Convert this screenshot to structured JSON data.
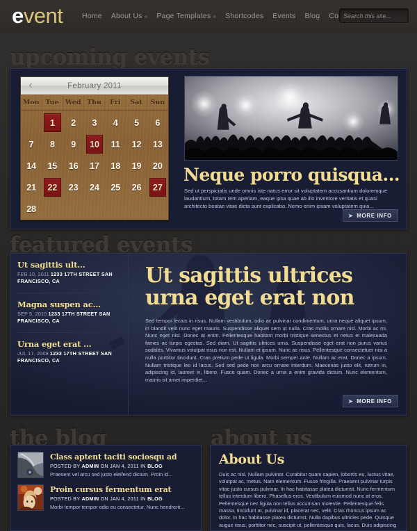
{
  "header": {
    "logo_primary": "e",
    "logo_secondary": "vent",
    "nav": [
      {
        "label": "Home",
        "caret": ""
      },
      {
        "label": "About Us",
        "caret": "»"
      },
      {
        "label": "Page Templates",
        "caret": "»"
      },
      {
        "label": "Shortcodes",
        "caret": ""
      },
      {
        "label": "Events",
        "caret": ""
      },
      {
        "label": "Blog",
        "caret": ""
      },
      {
        "label": "Contact",
        "caret": ""
      }
    ],
    "search": {
      "placeholder": "Search this site...",
      "value": "",
      "icon": "search-icon"
    }
  },
  "sections": {
    "upcoming_heading": "upcoming events",
    "featured_heading": "featured events",
    "blog_heading": "the blog",
    "about_heading": "about us"
  },
  "calendar": {
    "prev_icon": "‹",
    "title": "February 2011",
    "daynames": [
      "Mon",
      "Tue",
      "Wed",
      "Thu",
      "Fri",
      "Sat",
      "Sun"
    ],
    "lead_blanks": 1,
    "days": [
      1,
      2,
      3,
      4,
      5,
      6,
      7,
      8,
      9,
      10,
      11,
      12,
      13,
      14,
      15,
      16,
      17,
      18,
      19,
      20,
      21,
      22,
      23,
      24,
      25,
      26,
      27,
      28
    ],
    "event_days": [
      1,
      10,
      22,
      27
    ]
  },
  "upcoming": {
    "photo_alt": "concert-crowd-photo",
    "title": "Neque porro quisqua...",
    "description": "Sed ut perspiciatis unde omnis iste natus error sit voluptatem accusantium doloremque laudantium, totam rem aperiam, eaque ipsa quae ab illo inventore veritatis et quasi architecto beatae vitae dicta sunt explicabo. Nemo enim ipsam voluptatem quia...",
    "more_info_label": "MORE INFO",
    "more_info_arrow": "➤"
  },
  "featured": {
    "items": [
      {
        "title": "Ut sagittis ult...",
        "date": "FEB 10, 2011",
        "address": "1233 17TH STREET SAN FRANCISCO, CA"
      },
      {
        "title": "Magna suspen ac...",
        "date": "SEP 5, 2010",
        "address": "1233 17TH STREET SAN FRANCISCO, CA"
      },
      {
        "title": "Urna eget erat ...",
        "date": "JUL 17, 2008",
        "address": "1233 17TH STREET SAN FRANCISCO, CA"
      }
    ],
    "title": "Ut sagittis ultrices urna eget erat non",
    "body": "Sed tempor lectus in risus. Nullam vestibulum, odio ac pulvinar condimentum, urna neque aliquet ipsum, in blandit velit nunc eget mauris. Suspendisse aliquet sem ut nulla. Cras mollis ornare nisl. Morbi ac mi. Nunc eget nisi. Donec at enim. Pellentesque habitant morbi tristique senectus et netus et malesuada fames ac turpis egestas. Sed diam. Ut sagittis ultrices urna. Suspendisse eget erat non purus varius sodales. Vivamus volutpat risus non est. Nullam et ipsum. Nunc ac risus. Pellentesque consectetuer nisi a nulla porttitor tincidunt. Cras pretium pede ut ligula. Morbi semper ante. Nullam ac erat. Donec a ipsum. Nullam tristique leo id lacus. Sed sed pede non arcu ornare interdum. Maecenas justo elit, rutrum in, adipiscing id, laoreet in, libero. Fusce quam. Donec a urna a enim gravida dictum. Nunc elementum, mauris sit amet imperdiet...",
    "more_info_label": "MORE INFO",
    "more_info_arrow": "➤"
  },
  "blog": {
    "posts": [
      {
        "thumb": "architecture-thumb",
        "title": "Class aptent taciti sociosqu ad",
        "meta_prefix": "POSTED BY",
        "author": "ADMIN",
        "meta_on": "ON",
        "date": "JAN 4, 2011",
        "meta_in": "IN",
        "category": "BLOG",
        "excerpt": "Praesent vel arcu sed justo eleifend dictum. Proin id..."
      },
      {
        "thumb": "portrait-thumb",
        "title": "Proin cursus fermentum erat",
        "meta_prefix": "POSTED BY",
        "author": "ADMIN",
        "meta_on": "ON",
        "date": "JAN 4, 2011",
        "meta_in": "IN",
        "category": "BLOG",
        "excerpt": "Morbi tempor tempor odio eu consectetur. Nunc hendrerit..."
      }
    ]
  },
  "about": {
    "title": "About Us",
    "body": "Duis ac nisl. Nullam pulvinar. Curabitur quam sapien, lobortis eu, luctus vitae, volutpat ac, metus. Nam elementum. Fusce fringilla. Praesent pulvinar turpis vitae justo cursus pulvinar. In hac habitasse platea dictumst. Nunc fermentum tellus interdum libero. Phasellus eros. Vestibulum euismod nunc at eros. Pellentesque nec ligula non tellus accumsan molestie. Pellentesque felis massa, tincidunt at, pulvinar id, placerat nec, velit. Cras rhoncus ipsum ac dolor. In hac habitasse platea dictumst. Nulla dapibus ultricies pede. Quisque augue risus, porttitor nec, suscipit ut, pellentesque quis, lacus. Duis adipiscing nunc eu metus."
  },
  "colors": {
    "accent_gold": "#f2dc92",
    "panel_bg": "#181d33",
    "page_bg": "#2b2b2b",
    "event_red": "#8f1c1c",
    "calendar_wood": "#8c6437"
  }
}
